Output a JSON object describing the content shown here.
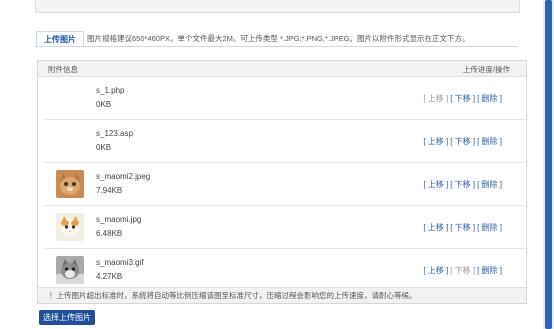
{
  "tab": {
    "label": "上传图片"
  },
  "hint": "图片规格建议650*460PX，单个文件最大2M。可上传类型 *.JPG;*.PNG;*.JPEG。图片以附件形式显示在正文下方。",
  "table": {
    "header_left": "附件信息",
    "header_right": "上传进度/操作"
  },
  "files": [
    {
      "name": "s_1.php",
      "size": "0KB",
      "thumb": "none",
      "ops": [
        {
          "label": "[ 上移 ]",
          "enabled": false
        },
        {
          "label": "[ 下移 ]",
          "enabled": true
        },
        {
          "label": "[ 删除 ]",
          "enabled": true
        }
      ]
    },
    {
      "name": "s_123.asp",
      "size": "0KB",
      "thumb": "none",
      "ops": [
        {
          "label": "[ 上移 ]",
          "enabled": true
        },
        {
          "label": "[ 下移 ]",
          "enabled": true
        },
        {
          "label": "[ 删除 ]",
          "enabled": true
        }
      ]
    },
    {
      "name": "s_maomi2.jpeg",
      "size": "7.94KB",
      "thumb": "cat-orange",
      "ops": [
        {
          "label": "[ 上移 ]",
          "enabled": true
        },
        {
          "label": "[ 下移 ]",
          "enabled": true
        },
        {
          "label": "[ 删除 ]",
          "enabled": true
        }
      ]
    },
    {
      "name": "s_maomi.jpg",
      "size": "6.48KB",
      "thumb": "cat-white-tan",
      "ops": [
        {
          "label": "[ 上移 ]",
          "enabled": true
        },
        {
          "label": "[ 下移 ]",
          "enabled": true
        },
        {
          "label": "[ 删除 ]",
          "enabled": true
        }
      ]
    },
    {
      "name": "s_maomi3.gif",
      "size": "4.27KB",
      "thumb": "cat-gray",
      "ops": [
        {
          "label": "[ 上移 ]",
          "enabled": true
        },
        {
          "label": "[ 下移 ]",
          "enabled": false
        },
        {
          "label": "[ 删除 ]",
          "enabled": true
        }
      ]
    }
  ],
  "notice": "！上传图片超出标准时，系统将自动等比例压缩该图至标准尺寸，压缩过程会影响您的上传速度，请耐心等候。",
  "select_button": "选择上传图片",
  "colors": {
    "accent": "#1f4f99",
    "link": "#2b5fa6",
    "disabled": "#999999"
  }
}
